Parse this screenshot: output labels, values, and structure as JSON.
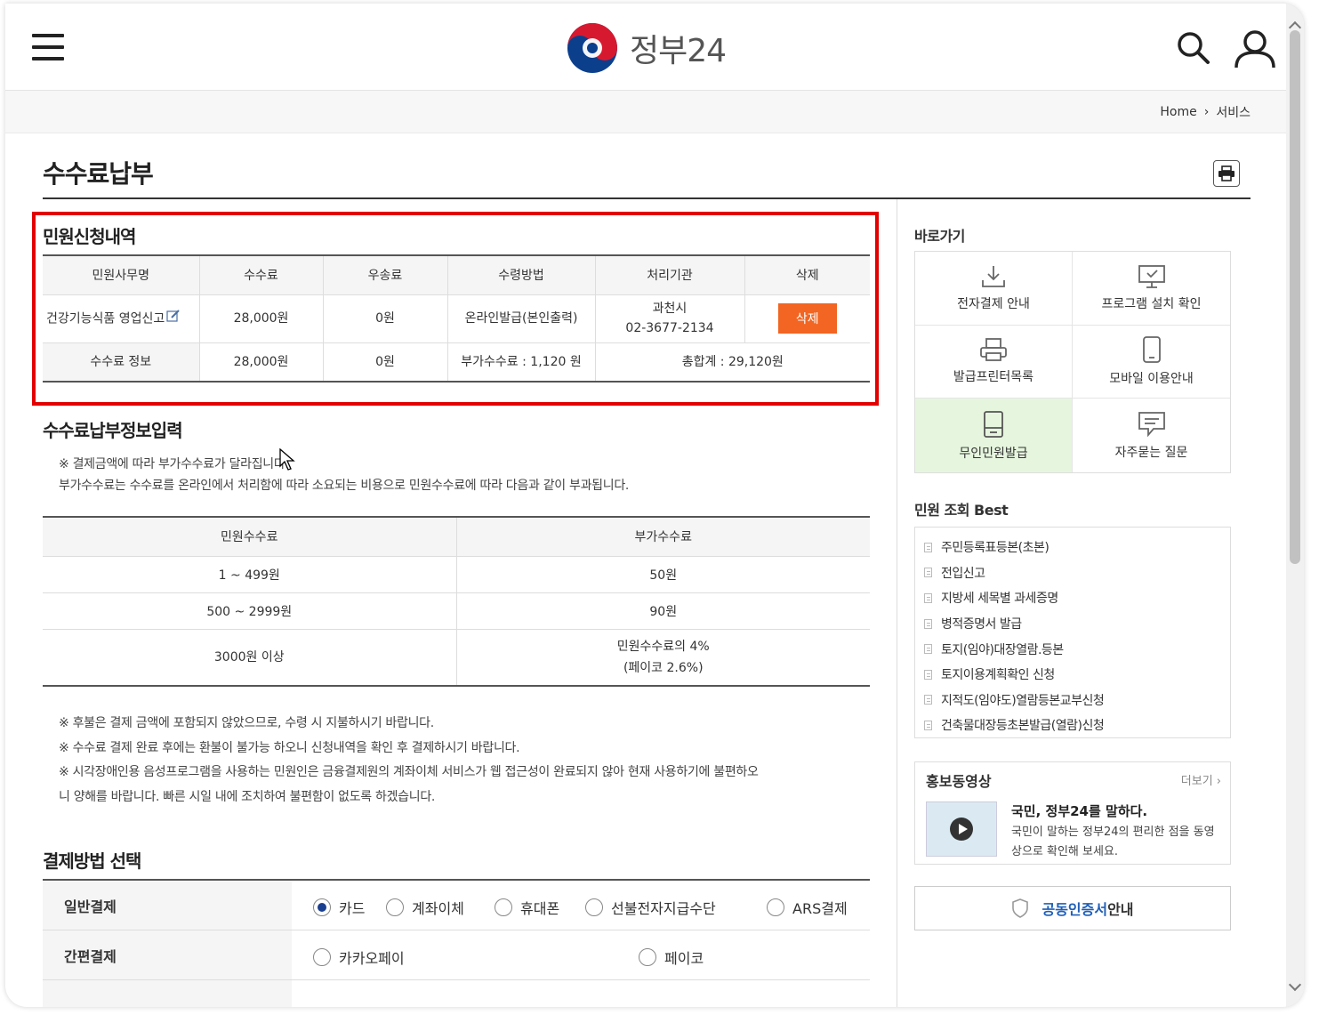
{
  "header": {
    "logo_text": "정부24"
  },
  "breadcrumb": {
    "home": "Home",
    "current": "서비스"
  },
  "page": {
    "title": "수수료납부"
  },
  "request": {
    "title": "민원신청내역",
    "columns": [
      "민원사무명",
      "수수료",
      "우송료",
      "수령방법",
      "처리기관",
      "삭제"
    ],
    "row": {
      "name": "건강기능식품 영업신고",
      "fee": "28,000원",
      "postage": "0원",
      "method": "온라인발급(본인출력)",
      "agency_name": "과천시",
      "agency_phone": "02-3677-2134",
      "delete_label": "삭제"
    },
    "summary": {
      "label": "수수료 정보",
      "fee": "28,000원",
      "postage": "0원",
      "extra": "부가수수료 : 1,120 원",
      "total": "총합계 : 29,120원"
    }
  },
  "fee_info": {
    "title": "수수료납부정보입력",
    "note1": "※ 결제금액에 따라 부가수수료가 달라집니다.",
    "note2": "부가수수료는 수수료를 온라인에서 처리함에 따라 소요되는 비용으로 민원수수료에 따라 다음과 같이 부과됩니다.",
    "columns": [
      "민원수수료",
      "부가수수료"
    ],
    "rows": [
      {
        "range": "1 ~ 499원",
        "extra": "50원"
      },
      {
        "range": "500 ~ 2999원",
        "extra": "90원"
      },
      {
        "range": "3000원 이상",
        "extra": "민원수수료의 4%",
        "extra2": "(페이코 2.6%)"
      }
    ],
    "warn1": "※ 후불은 결제 금액에 포함되지 않았으므로, 수령 시 지불하시기 바랍니다.",
    "warn2": "※ 수수료 결제 완료 후에는 환불이 불가능 하오니 신청내역을 확인 후 결제하시기 바랍니다.",
    "warn3a": "※ 시각장애인용 음성프로그램을 사용하는 민원인은 금융결제원의 계좌이체 서비스가 웹 접근성이 완료되지 않아 현재 사용하기에 불편하오",
    "warn3b": "니 양해를 바랍니다. 빠른 시일 내에 조치하여 불편함이 없도록 하겠습니다."
  },
  "payment": {
    "title": "결제방법 선택",
    "general_label": "일반결제",
    "general_options": [
      "카드",
      "계좌이체",
      "휴대폰",
      "선불전자지급수단",
      "ARS결제"
    ],
    "general_selected": "카드",
    "simple_label": "간편결제",
    "simple_options": [
      "카카오페이",
      "페이코"
    ]
  },
  "sidebar": {
    "quick_title": "바로가기",
    "quick_items": [
      {
        "label": "전자결제 안내",
        "icon": "download-icon"
      },
      {
        "label": "프로그램 설치 확인",
        "icon": "monitor-check-icon"
      },
      {
        "label": "발급프린터목록",
        "icon": "printer-icon"
      },
      {
        "label": "모바일 이용안내",
        "icon": "mobile-icon"
      },
      {
        "label": "무인민원발급",
        "icon": "kiosk-icon"
      },
      {
        "label": "자주묻는 질문",
        "icon": "faq-icon"
      }
    ],
    "best_title": "민원 조회 Best",
    "best_items": [
      "주민등록표등본(초본)",
      "전입신고",
      "지방세 세목별 과세증명",
      "병적증명서 발급",
      "토지(임야)대장열람.등본",
      "토지이용계획확인 신청",
      "지적도(임야도)열람등본교부신청",
      "건축물대장등초본발급(열람)신청"
    ],
    "promo": {
      "title": "홍보동영상",
      "more": "더보기 ›",
      "headline": "국민, 정부24를 말하다.",
      "desc": "국민이 말하는 정부24의 편리한 점을 동영상으로 확인해 보세요."
    },
    "cert": {
      "blue": "공동인증서",
      "rest": "안내"
    }
  },
  "colors": {
    "accent_orange": "#f26522",
    "highlight_red": "#e30000",
    "link_blue": "#1f5fb8",
    "active_green": "#e6f6de"
  }
}
